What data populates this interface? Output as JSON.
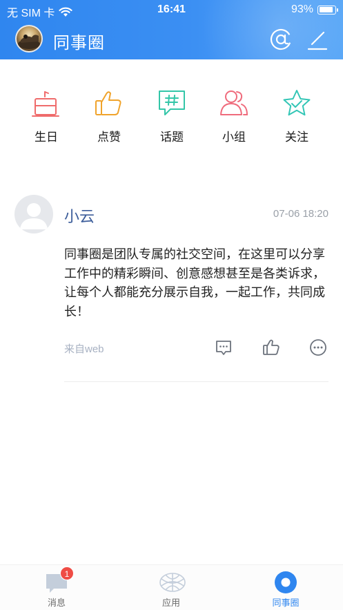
{
  "status_bar": {
    "carrier": "无 SIM 卡",
    "time": "16:41",
    "battery_percent": "93%",
    "battery_level": 0.93
  },
  "header": {
    "title": "同事圈",
    "at_icon": "at-icon",
    "edit_icon": "edit-icon"
  },
  "categories": [
    {
      "label": "生日",
      "icon": "birthday-cake-icon",
      "color": "#ef6b6b"
    },
    {
      "label": "点赞",
      "icon": "thumbs-up-icon",
      "color": "#f0a32b"
    },
    {
      "label": "话题",
      "icon": "topic-hashtag-icon",
      "color": "#33c6a8"
    },
    {
      "label": "小组",
      "icon": "group-icon",
      "color": "#ef6b7c"
    },
    {
      "label": "关注",
      "icon": "star-follow-icon",
      "color": "#33c6b6"
    }
  ],
  "post": {
    "author": "小云",
    "timestamp": "07-06 18:20",
    "content": "同事圈是团队专属的社交空间，在这里可以分享工作中的精彩瞬间、创意感想甚至是各类诉求，让每个人都能充分展示自我，一起工作，共同成长！",
    "source": "来自web",
    "actions": [
      "comment-icon",
      "like-icon",
      "more-icon"
    ]
  },
  "tabbar": {
    "tabs": [
      {
        "label": "消息",
        "icon": "message-icon",
        "badge": "1",
        "active": false
      },
      {
        "label": "应用",
        "icon": "apps-icon",
        "active": false
      },
      {
        "label": "同事圈",
        "icon": "colleague-circle-icon",
        "active": true
      }
    ]
  },
  "colors": {
    "header_blue": "#2f86ef",
    "name_blue": "#3c5d9a",
    "badge_red": "#ef4c45"
  }
}
